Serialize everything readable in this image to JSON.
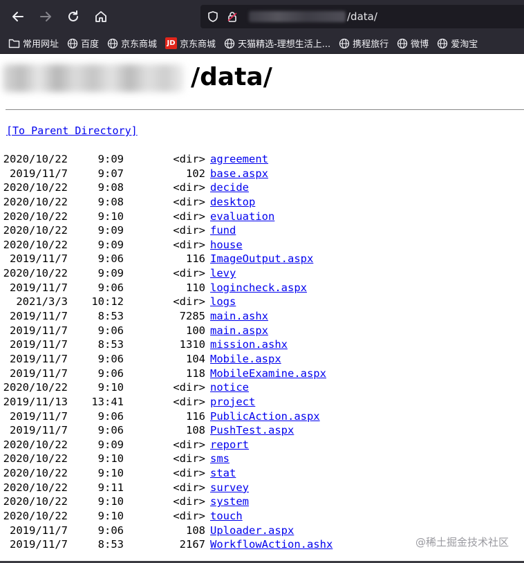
{
  "browser": {
    "url_path": "/data/",
    "bookmarks": [
      {
        "label": "常用网址",
        "icon": "folder-icon"
      },
      {
        "label": "百度",
        "icon": "globe-icon"
      },
      {
        "label": "京东商城",
        "icon": "globe-icon"
      },
      {
        "label": "京东商城",
        "icon": "jd-logo-icon",
        "icon_text": "JD"
      },
      {
        "label": "天猫精选-理想生活上...",
        "icon": "globe-icon"
      },
      {
        "label": "携程旅行",
        "icon": "globe-icon"
      },
      {
        "label": "微博",
        "icon": "globe-icon"
      },
      {
        "label": "爱淘宝",
        "icon": "globe-icon"
      }
    ]
  },
  "page": {
    "title": "/data/",
    "parent_link": "[To Parent Directory]",
    "watermark": "@稀土掘金技术社区",
    "entries": [
      {
        "date": "2020/10/22",
        "time": "9:09",
        "size": "<dir>",
        "name": "agreement"
      },
      {
        "date": "2019/11/7",
        "time": "9:07",
        "size": "102",
        "name": "base.aspx"
      },
      {
        "date": "2020/10/22",
        "time": "9:08",
        "size": "<dir>",
        "name": "decide"
      },
      {
        "date": "2020/10/22",
        "time": "9:08",
        "size": "<dir>",
        "name": "desktop"
      },
      {
        "date": "2020/10/22",
        "time": "9:10",
        "size": "<dir>",
        "name": "evaluation"
      },
      {
        "date": "2020/10/22",
        "time": "9:09",
        "size": "<dir>",
        "name": "fund"
      },
      {
        "date": "2020/10/22",
        "time": "9:09",
        "size": "<dir>",
        "name": "house"
      },
      {
        "date": "2019/11/7",
        "time": "9:06",
        "size": "116",
        "name": "ImageOutput.aspx"
      },
      {
        "date": "2020/10/22",
        "time": "9:09",
        "size": "<dir>",
        "name": "levy"
      },
      {
        "date": "2019/11/7",
        "time": "9:06",
        "size": "110",
        "name": "logincheck.aspx"
      },
      {
        "date": "2021/3/3",
        "time": "10:12",
        "size": "<dir>",
        "name": "logs"
      },
      {
        "date": "2019/11/7",
        "time": "8:53",
        "size": "7285",
        "name": "main.ashx"
      },
      {
        "date": "2019/11/7",
        "time": "9:06",
        "size": "100",
        "name": "main.aspx"
      },
      {
        "date": "2019/11/7",
        "time": "8:53",
        "size": "1310",
        "name": "mission.ashx"
      },
      {
        "date": "2019/11/7",
        "time": "9:06",
        "size": "104",
        "name": "Mobile.aspx"
      },
      {
        "date": "2019/11/7",
        "time": "9:06",
        "size": "118",
        "name": "MobileExamine.aspx"
      },
      {
        "date": "2020/10/22",
        "time": "9:10",
        "size": "<dir>",
        "name": "notice"
      },
      {
        "date": "2019/11/13",
        "time": "13:41",
        "size": "<dir>",
        "name": "project"
      },
      {
        "date": "2019/11/7",
        "time": "9:06",
        "size": "116",
        "name": "PublicAction.aspx"
      },
      {
        "date": "2019/11/7",
        "time": "9:06",
        "size": "108",
        "name": "PushTest.aspx"
      },
      {
        "date": "2020/10/22",
        "time": "9:09",
        "size": "<dir>",
        "name": "report"
      },
      {
        "date": "2020/10/22",
        "time": "9:10",
        "size": "<dir>",
        "name": "sms"
      },
      {
        "date": "2020/10/22",
        "time": "9:10",
        "size": "<dir>",
        "name": "stat"
      },
      {
        "date": "2020/10/22",
        "time": "9:11",
        "size": "<dir>",
        "name": "survey"
      },
      {
        "date": "2020/10/22",
        "time": "9:10",
        "size": "<dir>",
        "name": "system"
      },
      {
        "date": "2020/10/22",
        "time": "9:10",
        "size": "<dir>",
        "name": "touch"
      },
      {
        "date": "2019/11/7",
        "time": "9:06",
        "size": "108",
        "name": "Uploader.aspx"
      },
      {
        "date": "2019/11/7",
        "time": "8:53",
        "size": "2167",
        "name": "WorkflowAction.ashx"
      }
    ]
  },
  "colors": {
    "chrome_bg": "#2b2a33",
    "urlbar_bg": "#1c1b22",
    "link": "#0000ee",
    "insecure_lock": "#e22850"
  }
}
